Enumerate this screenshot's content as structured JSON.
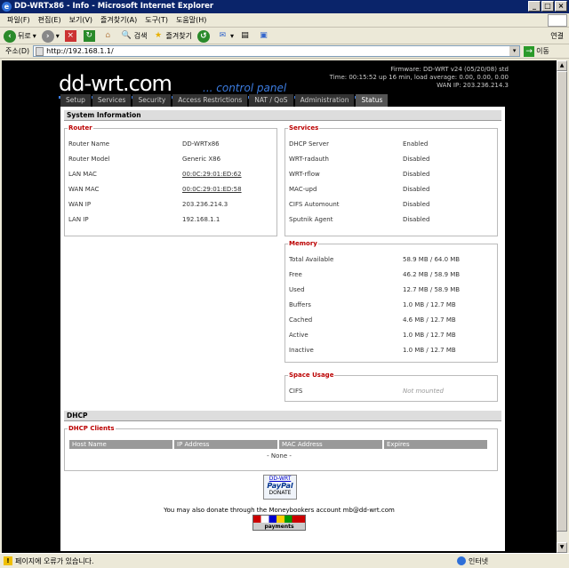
{
  "window": {
    "title": "DD-WRTx86 - Info - Microsoft Internet Explorer",
    "buttons": {
      "min": "_",
      "max": "□",
      "close": "×"
    }
  },
  "menu": [
    "파일(F)",
    "편집(E)",
    "보기(V)",
    "즐겨찾기(A)",
    "도구(T)",
    "도움말(H)"
  ],
  "toolbar": {
    "back": "뒤로",
    "search": "검색",
    "favorites": "즐겨찾기",
    "links": "연결"
  },
  "address": {
    "label": "주소(D)",
    "url": "http://192.168.1.1/",
    "go": "이동"
  },
  "header": {
    "logo_main": "dd-wrt",
    "logo_dot": ".com",
    "logo_sub": "... control panel",
    "firmware": "Firmware: DD-WRT v24 (05/20/08) std",
    "time": "Time: 00:15:52 up 16 min, load average: 0.00, 0.00, 0.00",
    "wan_ip": "WAN IP: 203.236.214.3"
  },
  "tabs": [
    "Setup",
    "Services",
    "Security",
    "Access Restrictions",
    "NAT / QoS",
    "Administration",
    "Status"
  ],
  "system_info": {
    "title": "System Information",
    "router": {
      "legend": "Router",
      "rows": [
        {
          "k": "Router Name",
          "v": "DD-WRTx86"
        },
        {
          "k": "Router Model",
          "v": "Generic X86"
        },
        {
          "k": "LAN MAC",
          "v": "00:0C:29:01:ED:62"
        },
        {
          "k": "WAN MAC",
          "v": "00:0C:29:01:ED:58"
        },
        {
          "k": "WAN IP",
          "v": "203.236.214.3"
        },
        {
          "k": "LAN IP",
          "v": "192.168.1.1"
        }
      ]
    },
    "services": {
      "legend": "Services",
      "rows": [
        {
          "k": "DHCP Server",
          "v": "Enabled"
        },
        {
          "k": "WRT-radauth",
          "v": "Disabled"
        },
        {
          "k": "WRT-rflow",
          "v": "Disabled"
        },
        {
          "k": "MAC-upd",
          "v": "Disabled"
        },
        {
          "k": "CIFS Automount",
          "v": "Disabled"
        },
        {
          "k": "Sputnik Agent",
          "v": "Disabled"
        }
      ]
    },
    "memory": {
      "legend": "Memory",
      "rows": [
        {
          "k": "Total Available",
          "v": "58.9 MB / 64.0 MB"
        },
        {
          "k": "Free",
          "v": "46.2 MB / 58.9 MB"
        },
        {
          "k": "Used",
          "v": "12.7 MB / 58.9 MB"
        },
        {
          "k": "Buffers",
          "v": "1.0 MB / 12.7 MB"
        },
        {
          "k": "Cached",
          "v": "4.6 MB / 12.7 MB"
        },
        {
          "k": "Active",
          "v": "1.0 MB / 12.7 MB"
        },
        {
          "k": "Inactive",
          "v": "1.0 MB / 12.7 MB"
        }
      ]
    },
    "space": {
      "legend": "Space Usage",
      "rows": [
        {
          "k": "CIFS",
          "v": "Not mounted"
        }
      ]
    }
  },
  "dhcp": {
    "title": "DHCP",
    "legend": "DHCP Clients",
    "columns": [
      "Host Name",
      "IP Address",
      "MAC Address",
      "Expires"
    ],
    "none": "- None -"
  },
  "donate": {
    "ddwrt": "DD-WRT",
    "paypal": "PayPal",
    "donate": "DONATE",
    "text": "You may also donate through the Moneybookers account mb@dd-wrt.com",
    "payments": "payments"
  },
  "status": {
    "left": "페이지에 오류가 있습니다.",
    "zone": "인터넷"
  }
}
